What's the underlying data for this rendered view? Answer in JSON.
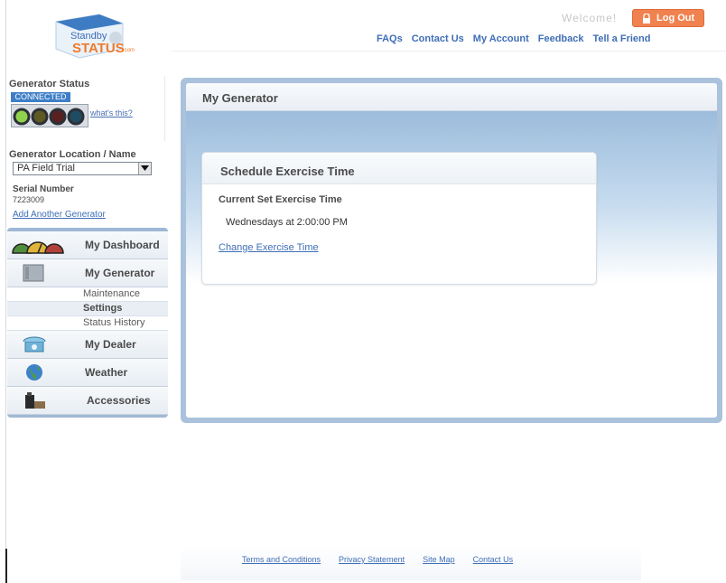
{
  "header": {
    "logo_text_top": "Standby",
    "logo_text_main": "STATUS",
    "logo_text_suffix": ".com",
    "welcome": "Welcome!",
    "logout_label": "Log Out",
    "nav": [
      "FAQs",
      "Contact Us",
      "My Account",
      "Feedback",
      "Tell a Friend"
    ]
  },
  "status": {
    "title": "Generator Status",
    "badge": "CONNECTED",
    "whats_this": "what's this?",
    "lights": [
      "green",
      "yellow",
      "red",
      "blue"
    ]
  },
  "location": {
    "title": "Generator Location / Name",
    "selected": "PA Field Trial",
    "serial_label": "Serial Number",
    "serial_value": "7223009",
    "add_link": "Add Another Generator"
  },
  "sidebar": {
    "items": [
      {
        "label": "My Dashboard",
        "icon": "gauges-icon"
      },
      {
        "label": "My Generator",
        "icon": "generator-icon"
      },
      {
        "label": "My Dealer",
        "icon": "phone-icon"
      },
      {
        "label": "Weather",
        "icon": "globe-icon"
      },
      {
        "label": "Accessories",
        "icon": "oil-can-icon"
      }
    ],
    "sub_items": [
      {
        "label": "Maintenance",
        "active": false
      },
      {
        "label": "Settings",
        "active": true
      },
      {
        "label": "Status History",
        "active": false
      }
    ]
  },
  "main": {
    "title": "My Generator",
    "card": {
      "title": "Schedule Exercise Time",
      "current_label": "Current Set Exercise Time",
      "current_value": "Wednesdays at 2:00:00 PM",
      "change_link": "Change Exercise Time"
    }
  },
  "footer": {
    "links": [
      "Terms and Conditions",
      "Privacy Statement",
      "Site Map",
      "Contact Us"
    ]
  },
  "colors": {
    "accent_blue": "#3f6eb6",
    "logout_orange": "#f0824f",
    "frame_blue": "#aac2dc"
  }
}
